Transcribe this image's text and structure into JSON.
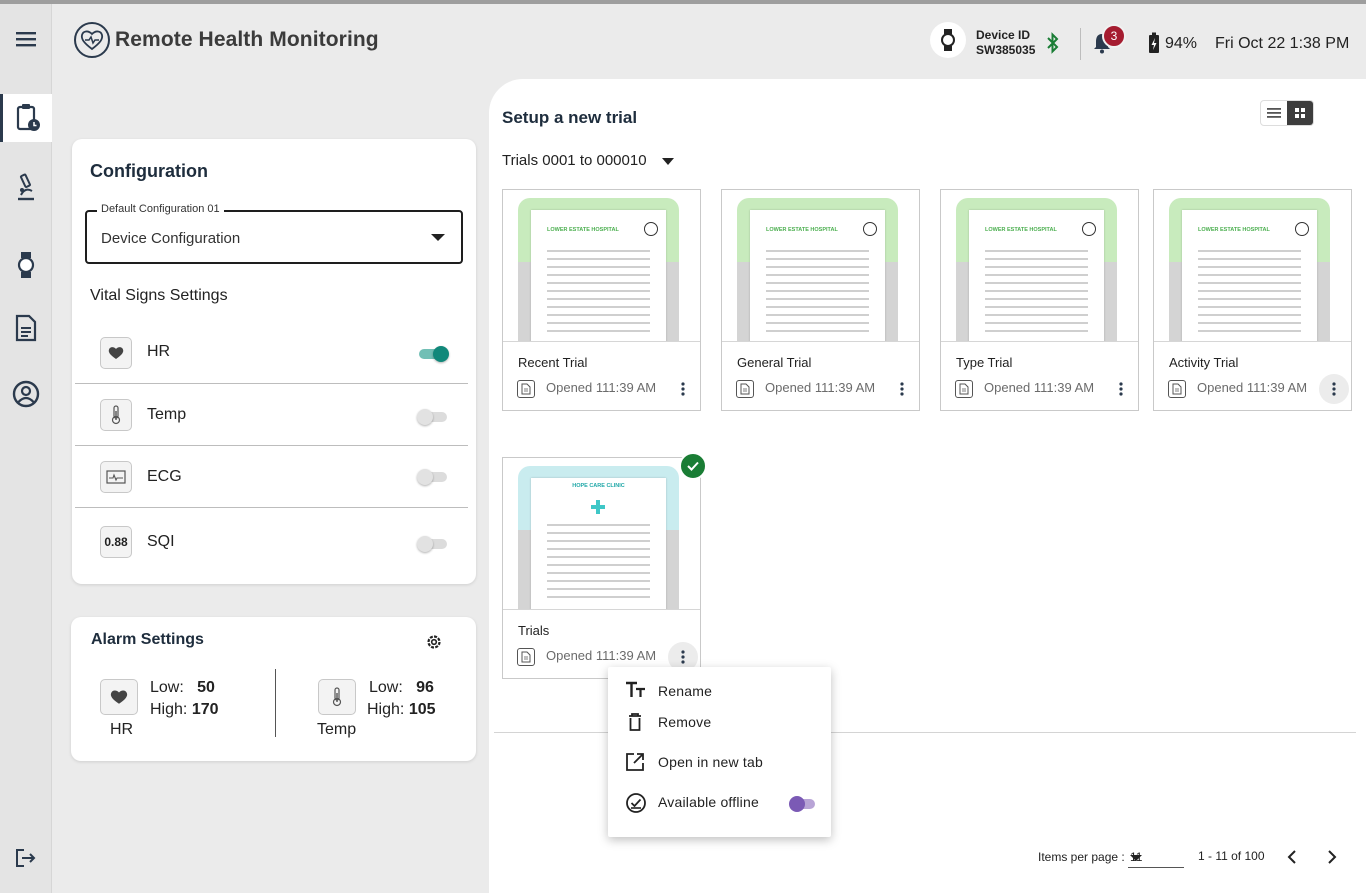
{
  "header": {
    "app_title": "Remote Health Monitoring",
    "device_id_label": "Device ID",
    "device_id": "SW385035",
    "notifications_count": "3",
    "battery": "94%",
    "datetime": "Fri Oct 22  1:38 PM"
  },
  "rail": {
    "items": [
      "menu-icon",
      "clipboard-clock-icon",
      "microscope-icon",
      "watch-icon",
      "document-icon",
      "account-circle-icon"
    ],
    "bottom": "logout-icon"
  },
  "configuration": {
    "title": "Configuration",
    "select_legend": "Default Configuration 01",
    "select_value": "Device Configuration",
    "vitals_title": "Vital Signs Settings",
    "vitals": [
      {
        "label": "HR",
        "icon": "heart-icon",
        "enabled": true
      },
      {
        "label": "Temp",
        "icon": "thermometer-icon",
        "enabled": false
      },
      {
        "label": "ECG",
        "icon": "ecg-icon",
        "enabled": false
      },
      {
        "label": "SQI",
        "icon_text": "0.88",
        "enabled": false
      }
    ]
  },
  "alarm": {
    "title": "Alarm Settings",
    "hr": {
      "name": "HR",
      "low_label": "Low:",
      "low": "50",
      "high_label": "High:",
      "high": "170"
    },
    "temp": {
      "name": "Temp",
      "low_label": "Low:",
      "low": "96",
      "high_label": "High:",
      "high": "105"
    }
  },
  "main": {
    "title": "Setup a new trial",
    "range": "Trials 0001 to 000010",
    "trials": [
      {
        "name": "Recent Trial",
        "opened": "Opened 111:39 AM",
        "hospital": "LOWER ESTATE HOSPITAL"
      },
      {
        "name": "General Trial",
        "opened": "Opened 111:39 AM",
        "hospital": "LOWER ESTATE HOSPITAL"
      },
      {
        "name": "Type Trial",
        "opened": "Opened 111:39 AM",
        "hospital": "LOWER ESTATE HOSPITAL"
      },
      {
        "name": "Activity Trial",
        "opened": "Opened 111:39 AM",
        "hospital": "LOWER ESTATE HOSPITAL"
      },
      {
        "name": "Trials",
        "opened": "Opened 111:39 AM",
        "hospital": "HOPE CARE CLINIC"
      }
    ]
  },
  "context_menu": {
    "items": [
      {
        "label": "Rename",
        "icon": "text-format-icon"
      },
      {
        "label": "Remove",
        "icon": "trash-icon"
      },
      {
        "label": "Open in new tab",
        "icon": "open-in-new-icon"
      },
      {
        "label": "Available offline",
        "icon": "offline-check-icon"
      }
    ]
  },
  "pagination": {
    "items_per_page_label": "Items per page :",
    "items_per_page": "11",
    "range": "1 - 11 of 100"
  },
  "colors": {
    "accent_teal": "#11887a",
    "badge_red": "#a51c30",
    "check_green": "#1a7d35",
    "toggle_purple": "#7b5ab5",
    "navy": "#1e2d3d"
  }
}
